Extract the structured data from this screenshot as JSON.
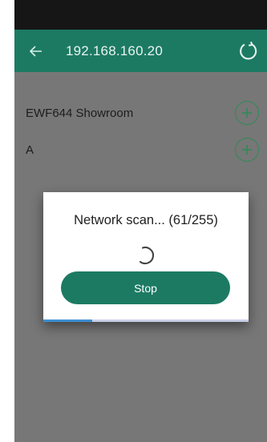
{
  "app_bar": {
    "title": "192.168.160.20",
    "back_icon": "arrow-left-icon",
    "refresh_icon": "refresh-icon"
  },
  "devices": [
    {
      "label": "EWF644 Showroom",
      "action_icon": "plus-circle-icon"
    },
    {
      "label": "A",
      "action_icon": "plus-circle-icon"
    }
  ],
  "dialog": {
    "title": "Network scan... (61/255)",
    "stop_label": "Stop",
    "progress_fraction": 0.239
  },
  "colors": {
    "primary": "#1c7a63",
    "accent_green": "#2f8a55",
    "progress": "#3e8fd1"
  }
}
